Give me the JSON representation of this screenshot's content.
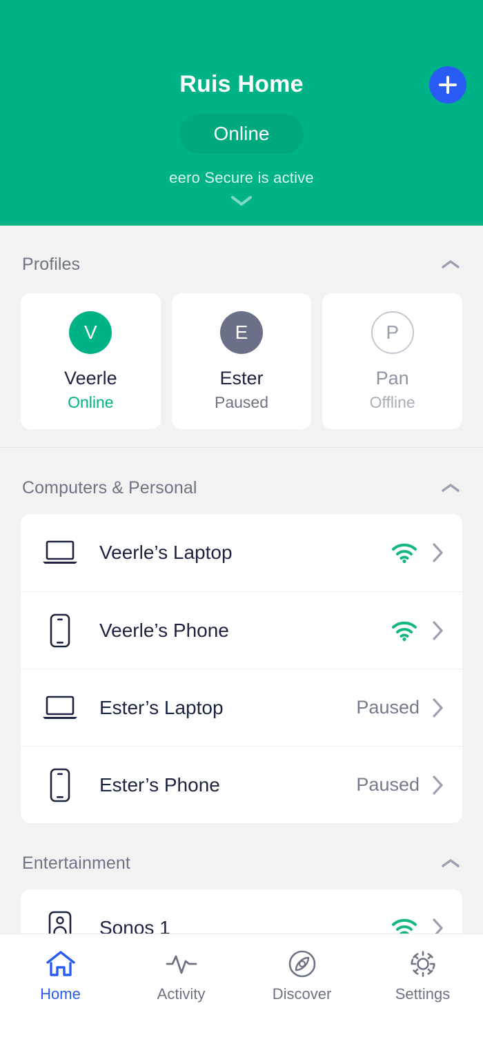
{
  "header": {
    "title": "Ruis Home",
    "status_pill": "Online",
    "secure_text": "eero Secure is active",
    "add_icon": "plus-icon",
    "expand_icon": "chevron-down-icon",
    "bg_color": "#00b386",
    "pill_color": "#00a87e",
    "add_button_color": "#2a5cf5"
  },
  "profiles": {
    "section_title": "Profiles",
    "collapse_icon": "chevron-up-icon",
    "items": [
      {
        "initial": "V",
        "name": "Veerle",
        "status": "Online",
        "avatar_style": "green",
        "status_style": "online"
      },
      {
        "initial": "E",
        "name": "Ester",
        "status": "Paused",
        "avatar_style": "slate",
        "status_style": "paused"
      },
      {
        "initial": "P",
        "name": "Pan",
        "status": "Offline",
        "avatar_style": "ghost",
        "status_style": "offline"
      }
    ]
  },
  "computers": {
    "section_title": "Computers & Personal",
    "collapse_icon": "chevron-up-icon",
    "devices": [
      {
        "name": "Veerle’s Laptop",
        "icon": "laptop-icon",
        "status": "",
        "connected": true
      },
      {
        "name": "Veerle’s Phone",
        "icon": "phone-icon",
        "status": "",
        "connected": true
      },
      {
        "name": "Ester’s Laptop",
        "icon": "laptop-icon",
        "status": "Paused",
        "connected": false
      },
      {
        "name": "Ester’s Phone",
        "icon": "phone-icon",
        "status": "Paused",
        "connected": false
      }
    ]
  },
  "entertainment": {
    "section_title": "Entertainment",
    "collapse_icon": "chevron-up-icon",
    "devices": [
      {
        "name": "Sonos 1",
        "icon": "speaker-icon",
        "status": "",
        "connected": true
      }
    ]
  },
  "bottom_nav": {
    "items": [
      {
        "label": "Home",
        "icon": "home-icon",
        "active": true
      },
      {
        "label": "Activity",
        "icon": "pulse-icon",
        "active": false
      },
      {
        "label": "Discover",
        "icon": "compass-icon",
        "active": false
      },
      {
        "label": "Settings",
        "icon": "gear-icon",
        "active": false
      }
    ],
    "active_color": "#2a5cf5",
    "inactive_color": "#6e7384"
  },
  "colors": {
    "brand_green": "#00b386",
    "accent_blue": "#2a5cf5",
    "page_bg": "#f2f2f3",
    "text_dark": "#1c2340",
    "text_muted": "#6e7384"
  }
}
